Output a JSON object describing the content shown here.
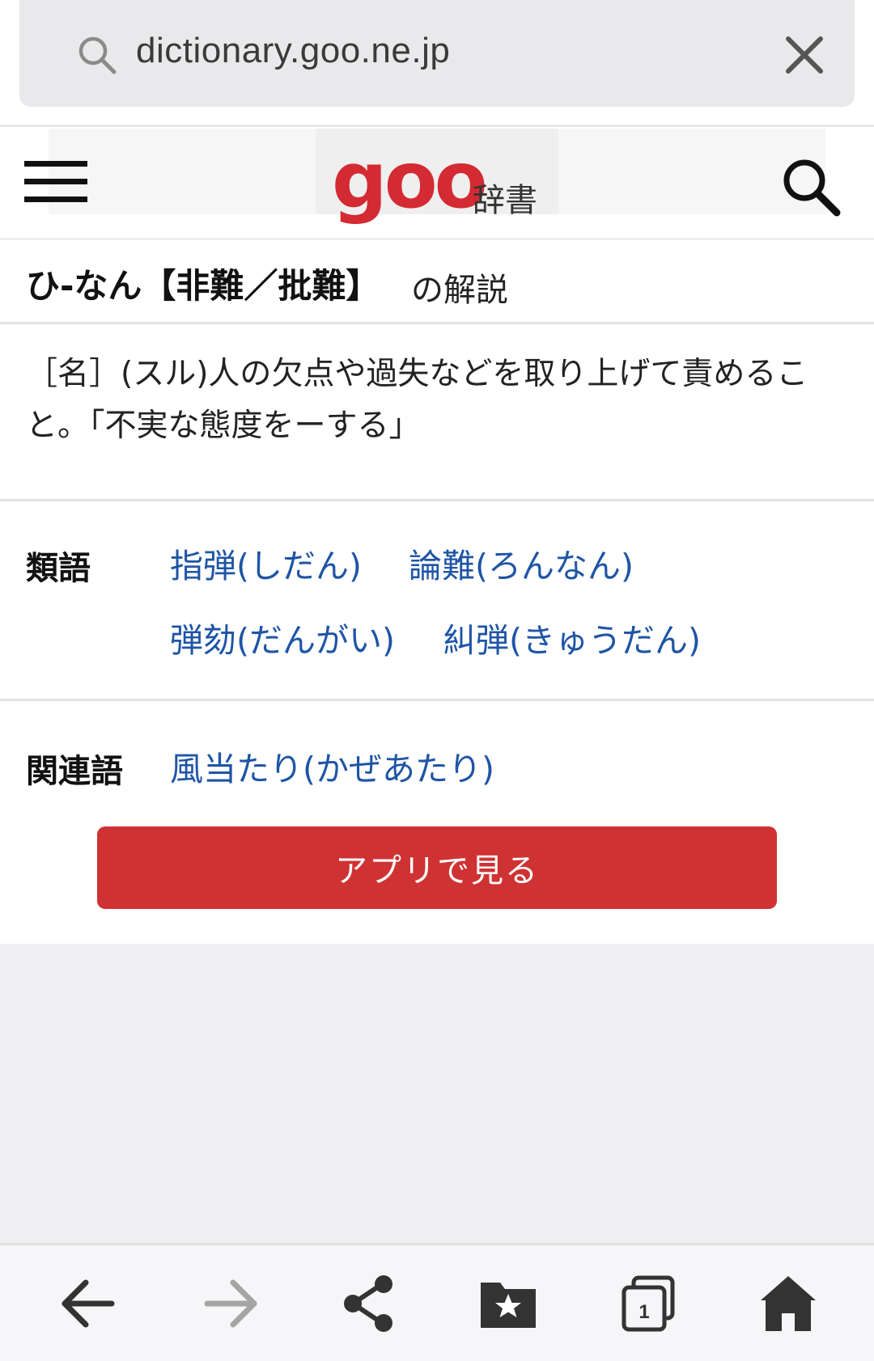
{
  "browser": {
    "url": "dictionary.goo.ne.jp"
  },
  "site": {
    "logo_text": "goo",
    "logo_suffix": "辞書"
  },
  "entry": {
    "headword": "ひ-なん【非難／批難】",
    "title_suffix": "の解説",
    "definition": "［名］(スル)人の欠点や過失などを取り上げて責めること。「不実な態度をーする」"
  },
  "synonyms": {
    "label": "類語",
    "items": [
      "指弾(しだん)",
      "論難(ろんなん)",
      "弾劾(だんがい)",
      "糾弾(きゅうだん)"
    ]
  },
  "related": {
    "label": "関連語",
    "items": [
      "風当たり(かぜあたり)"
    ]
  },
  "app_button_label": "アプリで見る",
  "bottom_bar": {
    "tab_count": "1",
    "icons": [
      "back-arrow-icon",
      "forward-arrow-icon",
      "share-icon",
      "bookmarks-folder-icon",
      "tabs-icon",
      "home-icon"
    ]
  },
  "colors": {
    "brand_red": "#d42a33",
    "button_red": "#cf3232",
    "link_blue": "#1f55a5",
    "urlbar_bg": "#e9e9eb",
    "page_bg": "#f0eff1"
  }
}
